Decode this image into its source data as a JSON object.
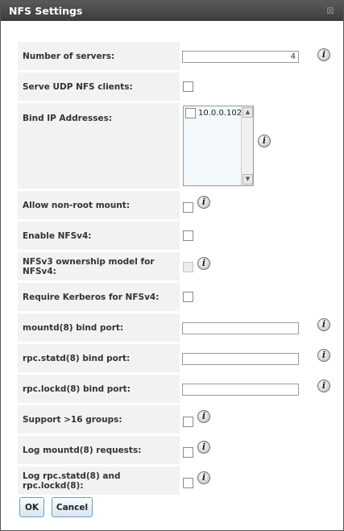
{
  "window": {
    "title": "NFS Settings",
    "close_glyph": "⊠"
  },
  "info_glyph": "i",
  "fields": [
    {
      "label": "Number of servers:",
      "type": "text",
      "value": "4",
      "info": "outside"
    },
    {
      "label": "Serve UDP NFS clients:",
      "type": "checkbox",
      "checked": false
    },
    {
      "label": "Bind IP Addresses:",
      "type": "listbox",
      "items": [
        "10.0.0.102"
      ],
      "info": "beside-list"
    },
    {
      "label": "Allow non-root mount:",
      "type": "checkbox",
      "checked": false,
      "info": "inline"
    },
    {
      "label": "Enable NFSv4:",
      "type": "checkbox",
      "checked": false
    },
    {
      "label": "NFSv3 ownership model for NFSv4:",
      "type": "checkbox",
      "disabled": true,
      "info": "inline"
    },
    {
      "label": "Require Kerberos for NFSv4:",
      "type": "checkbox",
      "checked": false
    },
    {
      "label": "mountd(8) bind port:",
      "type": "text",
      "value": "",
      "info": "outside"
    },
    {
      "label": "rpc.statd(8) bind port:",
      "type": "text",
      "value": "",
      "info": "outside"
    },
    {
      "label": "rpc.lockd(8) bind port:",
      "type": "text",
      "value": "",
      "info": "outside"
    },
    {
      "label": "Support >16 groups:",
      "type": "checkbox",
      "checked": false,
      "info": "inline"
    },
    {
      "label": "Log mountd(8) requests:",
      "type": "checkbox",
      "checked": false,
      "info": "inline"
    },
    {
      "label": "Log rpc.statd(8) and rpc.lockd(8):",
      "type": "checkbox",
      "checked": false,
      "info": "inline"
    }
  ],
  "buttons": {
    "ok": "OK",
    "cancel": "Cancel"
  }
}
